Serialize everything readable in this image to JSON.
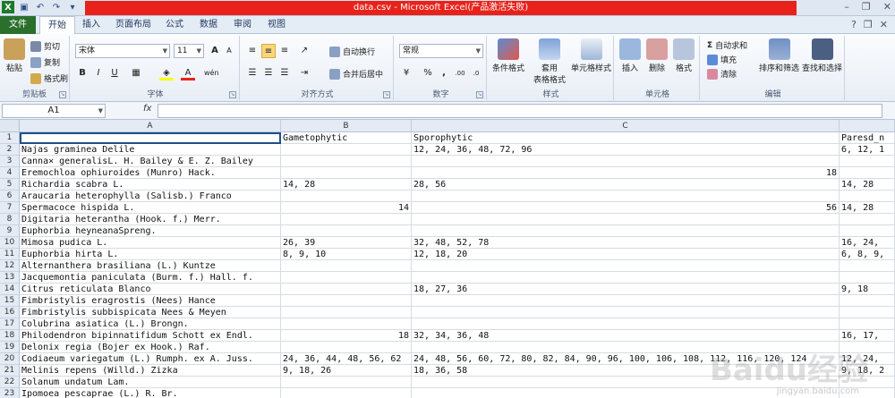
{
  "window": {
    "title": "data.csv  -  Microsoft Excel(产品激活失败)",
    "quick_access": [
      "save-icon",
      "undo-icon",
      "redo-icon",
      "customize-icon"
    ]
  },
  "ribbon_tabs": [
    "文件",
    "开始",
    "插入",
    "页面布局",
    "公式",
    "数据",
    "审阅",
    "视图"
  ],
  "ribbon": {
    "clipboard": {
      "paste": "粘贴",
      "cut": "剪切",
      "copy": "复制",
      "format_painter": "格式刷",
      "label": "剪贴板"
    },
    "font": {
      "name": "宋体",
      "size": "11",
      "label": "字体",
      "bold": "B",
      "italic": "I",
      "underline": "U",
      "grow": "A",
      "shrink": "A",
      "font_color": "A",
      "wen": "wén",
      "bold_shape": "字"
    },
    "alignment": {
      "wrap": "自动换行",
      "merge": "合并后居中",
      "label": "对齐方式"
    },
    "number": {
      "format": "常规",
      "label": "数字",
      "percent": "%",
      "comma": ",",
      "increase_decimal": ".00",
      "decrease_decimal": ".0"
    },
    "styles": {
      "conditional": "条件格式",
      "table": "套用",
      "table2": "表格格式",
      "cell_styles": "单元格样式",
      "label": "样式"
    },
    "cells": {
      "insert": "插入",
      "delete": "删除",
      "format": "格式",
      "label": "单元格"
    },
    "editing": {
      "autosum": "自动求和",
      "fill": "填充",
      "clear": "清除",
      "sort": "排序和筛选",
      "find": "查找和选择",
      "label": "编辑"
    }
  },
  "formula_bar": {
    "name_box": "A1",
    "fx": "fx",
    "content": ""
  },
  "columns": [
    "A",
    "B",
    "C",
    ""
  ],
  "rows": [
    {
      "n": "1",
      "a": "",
      "b": "Gametophytic",
      "c": "Sporophytic",
      "d": "Paresd_n"
    },
    {
      "n": "2",
      "a": "Najas graminea Delile",
      "b": "",
      "c": "12, 24, 36, 48, 72, 96",
      "d": "6, 12, 1"
    },
    {
      "n": "3",
      "a": "Canna× generalisL. H. Bailey & E. Z. Bailey",
      "b": "",
      "c": "",
      "d": ""
    },
    {
      "n": "4",
      "a": "Eremochloa ophiuroides (Munro) Hack.",
      "b": "",
      "c": "",
      "c_num": "18",
      "d": ""
    },
    {
      "n": "5",
      "a": "Richardia scabra L.",
      "b": "14, 28",
      "c": "28, 56",
      "d": "14, 28"
    },
    {
      "n": "6",
      "a": "Araucaria heterophylla (Salisb.) Franco",
      "b": "",
      "c": "",
      "d": ""
    },
    {
      "n": "7",
      "a": "Spermacoce hispida L.",
      "b_num": "14",
      "b": "",
      "c": "",
      "c_num": "56",
      "d": "14, 28"
    },
    {
      "n": "8",
      "a": "Digitaria heterantha (Hook. f.) Merr.",
      "b": "",
      "c": "",
      "d": ""
    },
    {
      "n": "9",
      "a": "Euphorbia heyneanaSpreng.",
      "b": "",
      "c": "",
      "d": ""
    },
    {
      "n": "10",
      "a": "Mimosa pudica L.",
      "b": "26, 39",
      "c": "32, 48, 52, 78",
      "d": "16, 24,"
    },
    {
      "n": "11",
      "a": "Euphorbia hirta L.",
      "b": "8, 9, 10",
      "c": "12, 18, 20",
      "d": "6, 8, 9,"
    },
    {
      "n": "12",
      "a": "Alternanthera brasiliana (L.) Kuntze",
      "b": "",
      "c": "",
      "d": ""
    },
    {
      "n": "13",
      "a": "Jacquemontia paniculata (Burm. f.) Hall. f.",
      "b": "",
      "c": "",
      "d": ""
    },
    {
      "n": "14",
      "a": "Citrus reticulata Blanco",
      "b": "",
      "c": "18, 27, 36",
      "d": "9, 18"
    },
    {
      "n": "15",
      "a": "Fimbristylis eragrostis (Nees) Hance",
      "b": "",
      "c": "",
      "d": ""
    },
    {
      "n": "16",
      "a": "Fimbristylis subbispicata Nees & Meyen",
      "b": "",
      "c": "",
      "d": ""
    },
    {
      "n": "17",
      "a": "Colubrina asiatica (L.) Brongn.",
      "b": "",
      "c": "",
      "d": ""
    },
    {
      "n": "18",
      "a": "Philodendron bipinnatifidum Schott ex Endl.",
      "b_num": "18",
      "b": "",
      "c": "32, 34, 36, 48",
      "d": "16, 17,"
    },
    {
      "n": "19",
      "a": "Delonix regia (Bojer ex Hook.) Raf.",
      "b": "",
      "c": "",
      "d": ""
    },
    {
      "n": "20",
      "a": "Codiaeum variegatum (L.) Rumph. ex A. Juss.",
      "b": "24, 36, 44, 48, 56, 62",
      "c": "24, 48, 56, 60, 72, 80, 82, 84, 90, 96, 100, 106, 108, 112, 116, 120, 124",
      "d": "12, 24,"
    },
    {
      "n": "21",
      "a": "Melinis repens (Willd.) Zizka",
      "b": "9, 18, 26",
      "c": "18, 36, 58",
      "d": "9, 18, 2"
    },
    {
      "n": "22",
      "a": "Solanum undatum Lam.",
      "b": "",
      "c": "",
      "d": ""
    },
    {
      "n": "23",
      "a": "Ipomoea pescaprae (L.) R. Br.",
      "b": "",
      "c": "",
      "d": ""
    }
  ],
  "watermark": {
    "text": "Baidu经验",
    "sub": "jingyan.baidu.com"
  },
  "colors": {
    "title_bar_accent": "#e8221b",
    "file_tab": "#2a6f2c",
    "selection": "#1f4e8a"
  }
}
